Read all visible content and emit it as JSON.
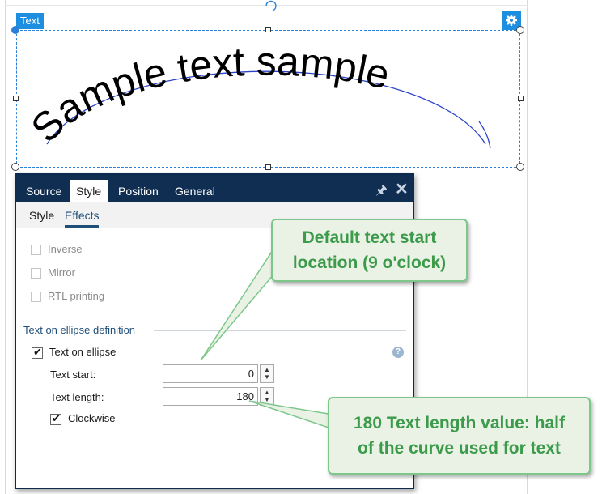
{
  "object": {
    "tag_label": "Text",
    "sample_text": "Sample text sample",
    "icons": {
      "settings": "gear-icon"
    }
  },
  "panel": {
    "tabs": [
      "Source",
      "Style",
      "Position",
      "General"
    ],
    "active_tab": "Style",
    "subtabs": [
      "Style",
      "Effects"
    ],
    "active_subtab": "Effects",
    "icons": {
      "pin": "pin-icon",
      "close": "close-icon",
      "help": "help-icon"
    },
    "options": [
      {
        "label": "Inverse",
        "checked": false,
        "enabled": false
      },
      {
        "label": "Mirror",
        "checked": false,
        "enabled": false
      },
      {
        "label": "RTL printing",
        "checked": false,
        "enabled": false
      }
    ],
    "section_title": "Text on ellipse definition",
    "text_on_ellipse": {
      "label": "Text on ellipse",
      "checked": true
    },
    "text_start": {
      "label": "Text start:",
      "value": "0"
    },
    "text_length": {
      "label": "Text length:",
      "value": "180"
    },
    "clockwise": {
      "label": "Clockwise",
      "checked": true
    }
  },
  "callouts": {
    "start": {
      "line1": "Default text start",
      "line2": "location (9 o'clock)"
    },
    "length": {
      "line1": "180 Text length value: half",
      "line2": "of the curve used for text"
    }
  },
  "colors": {
    "selection": "#1e8ee0",
    "panel_header": "#102e52",
    "callout_text": "#3c9a4b",
    "callout_border": "#7dc78b",
    "callout_bg": "#e9f2e5"
  }
}
